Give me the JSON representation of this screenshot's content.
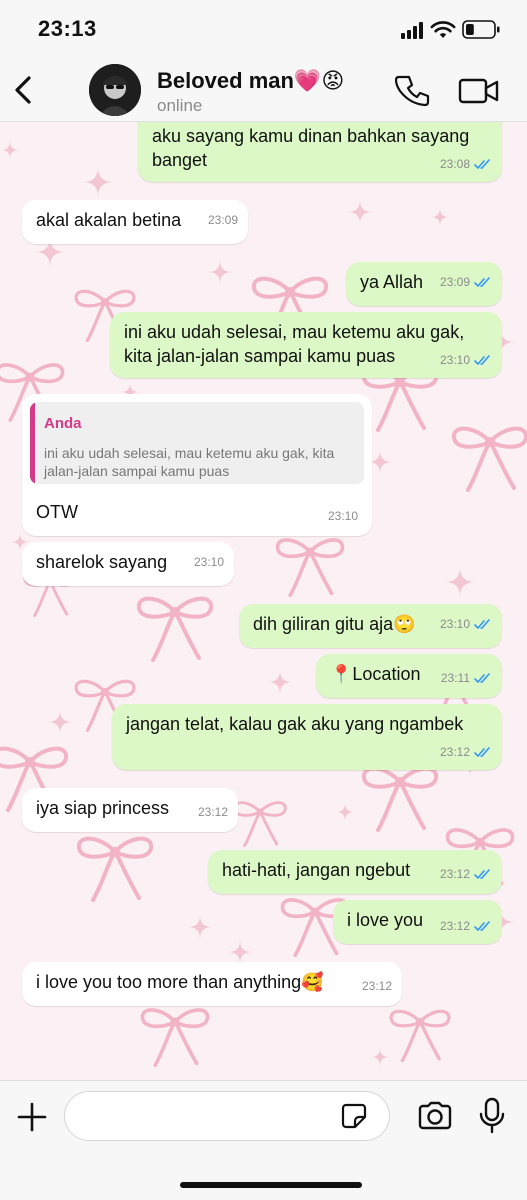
{
  "status_bar": {
    "time": "23:13",
    "battery_level": 0.3
  },
  "header": {
    "back_icon": "chevron-left-icon",
    "contact_name": "Beloved man💗😡",
    "contact_status": "online",
    "call_icon": "phone-icon",
    "video_icon": "video-camera-icon"
  },
  "messages": [
    {
      "dir": "out",
      "text": "aku sayang kamu dinan bahkan sayang banget",
      "time": "23:08",
      "read": true
    },
    {
      "dir": "in",
      "text": "akal akalan betina",
      "time": "23:09"
    },
    {
      "dir": "out",
      "text": "ya Allah",
      "time": "23:09",
      "read": true
    },
    {
      "dir": "out",
      "text": "ini aku udah selesai, mau ketemu aku gak, kita jalan-jalan sampai kamu puas",
      "time": "23:10",
      "read": true
    },
    {
      "dir": "in",
      "text": "OTW",
      "time": "23:10",
      "quote": {
        "author": "Anda",
        "text": "ini aku udah selesai, mau ketemu aku gak, kita jalan-jalan sampai kamu puas"
      }
    },
    {
      "dir": "in",
      "text": "sharelok sayang",
      "time": "23:10"
    },
    {
      "dir": "out",
      "text": "dih giliran gitu aja🙄",
      "time": "23:10",
      "read": true
    },
    {
      "dir": "out",
      "text": "📍Location",
      "time": "23:11",
      "read": true
    },
    {
      "dir": "out",
      "text": "jangan telat, kalau gak aku yang ngambek",
      "time": "23:12",
      "read": true
    },
    {
      "dir": "in",
      "text": "iya siap princess",
      "time": "23:12"
    },
    {
      "dir": "out",
      "text": "hati-hati, jangan ngebut",
      "time": "23:12",
      "read": true
    },
    {
      "dir": "out",
      "text": "i love you",
      "time": "23:12",
      "read": true
    },
    {
      "dir": "in",
      "text": "i love you too more than anything🥰",
      "time": "23:12"
    }
  ],
  "input_bar": {
    "placeholder": "",
    "plus_icon": "plus-icon",
    "sticker_icon": "sticker-icon",
    "camera_icon": "camera-icon",
    "mic_icon": "microphone-icon"
  },
  "colors": {
    "outgoing_bubble": "#dcf8c6",
    "incoming_bubble": "#ffffff",
    "read_ticks": "#3497f9",
    "quote_accent": "#d33b8a",
    "wallpaper": "#fbf0f3",
    "wallpaper_bow": "#f2b3c6"
  }
}
